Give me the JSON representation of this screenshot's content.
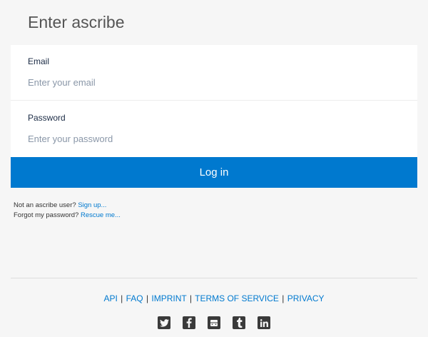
{
  "page": {
    "title": "Enter ascribe"
  },
  "form": {
    "email": {
      "label": "Email",
      "placeholder": "Enter your email",
      "value": ""
    },
    "password": {
      "label": "Password",
      "placeholder": "Enter your password",
      "value": ""
    },
    "submit_label": "Log in"
  },
  "help": {
    "signup_prompt": "Not an ascribe user?",
    "signup_link": "Sign up...",
    "forgot_prompt": "Forgot my password?",
    "forgot_link": "Rescue me..."
  },
  "footer": {
    "links": [
      "API",
      "FAQ",
      "IMPRINT",
      "TERMS OF SERVICE",
      "PRIVACY"
    ],
    "separator": "|"
  },
  "social": [
    {
      "icon": "twitter-icon"
    },
    {
      "icon": "facebook-icon"
    },
    {
      "icon": "github-icon"
    },
    {
      "icon": "tumblr-icon"
    },
    {
      "icon": "linkedin-icon"
    }
  ],
  "colors": {
    "accent": "#0079cf",
    "background": "#f6f6f6",
    "card": "#ffffff",
    "icon": "#3a3a3a"
  }
}
